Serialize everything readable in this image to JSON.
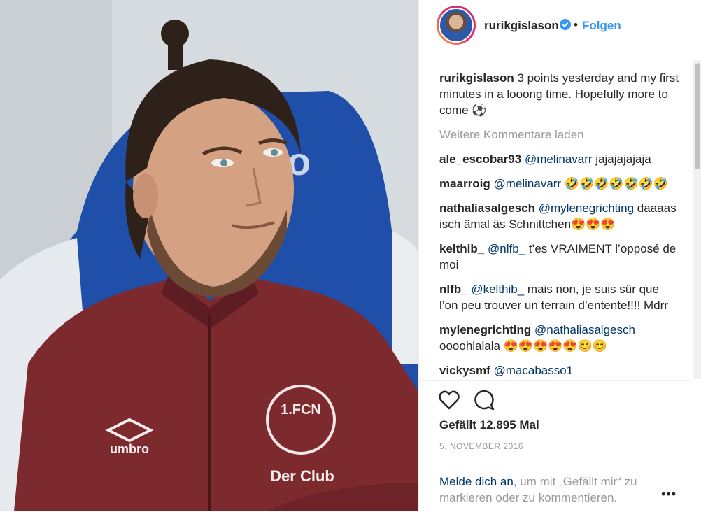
{
  "header": {
    "username": "rurikgislason",
    "separator": "•",
    "follow_label": "Folgen"
  },
  "caption": {
    "username": "rurikgislason",
    "text": "3 points yesterday and my first minutes in a looong time. Hopefully more to come ⚽"
  },
  "load_more": "Weitere Kommentare laden",
  "comments": [
    {
      "user": "ale_escobar93",
      "mention": "@melinavarr",
      "text": " jajajajajaja"
    },
    {
      "user": "maarroig",
      "mention": "@melinavarr",
      "text": " 🤣🤣🤣🤣🤣🤣🤣"
    },
    {
      "user": "nathaliasalgesch",
      "mention": "@mylenegrichting",
      "text": " daaaas isch ämal äs Schnittchen😍😍😍"
    },
    {
      "user": "kelthib_",
      "mention": "@nlfb_",
      "text": " t’es VRAIMENT l’opposé de moi"
    },
    {
      "user": "nlfb_",
      "mention": "@kelthib_",
      "text": " mais non, je suis sûr que l’on peu trouver un terrain d’entente!!!! Mdrr"
    },
    {
      "user": "mylenegrichting",
      "mention": "@nathaliasalgesch",
      "text": " oooohlalala 😍😍😍😍😍😊😊"
    },
    {
      "user": "vickysmf",
      "mention": "@macabasso1",
      "text": ""
    }
  ],
  "actions": {
    "likes": "Gefällt 12.895 Mal",
    "date": "5. NOVEMBER 2016"
  },
  "footer": {
    "login_link": "Melde dich an",
    "login_text": ", um mit „Gefällt mir“ zu markieren oder zu kommentieren.",
    "more": "•••"
  },
  "photo": {
    "jersey_crest_text": "1.FCN",
    "jersey_club_text": "Der Club",
    "jersey_brand_text": "umbro"
  },
  "colors": {
    "accent": "#3897f0",
    "link": "#003569",
    "muted": "#999999",
    "jersey": "#7d2a2f"
  }
}
